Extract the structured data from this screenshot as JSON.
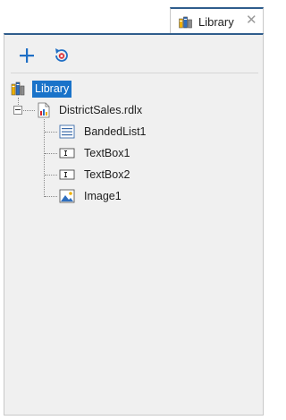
{
  "tab": {
    "title": "Library",
    "icon": "library-icon",
    "close_glyph": "✕"
  },
  "toolbar": {
    "add_icon": "plus-icon",
    "refresh_icon": "refresh-remove-icon"
  },
  "tree": {
    "root": {
      "label": "Library",
      "icon": "library-icon",
      "selected": true
    },
    "file": {
      "label": "DistrictSales.rdlx",
      "icon": "report-file-icon",
      "expanded": true
    },
    "items": [
      {
        "label": "BandedList1",
        "icon": "banded-list-icon"
      },
      {
        "label": "TextBox1",
        "icon": "textbox-icon"
      },
      {
        "label": "TextBox2",
        "icon": "textbox-icon"
      },
      {
        "label": "Image1",
        "icon": "image-icon"
      }
    ]
  },
  "colors": {
    "accent": "#2f5d8c",
    "selection": "#1a73c9",
    "panel_bg": "#f0f0f0",
    "add_blue": "#1f6fc5",
    "refresh_red": "#d9262c"
  }
}
